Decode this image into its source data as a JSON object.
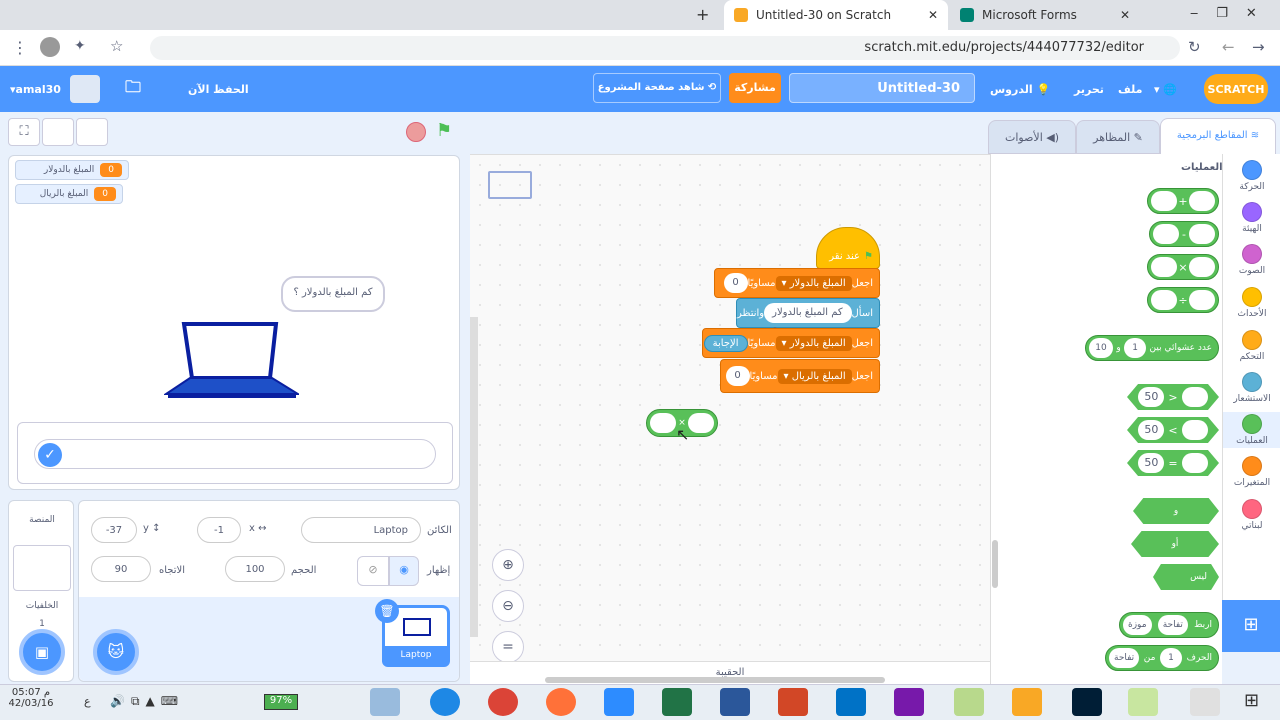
{
  "browser": {
    "tabs": [
      {
        "label": "Untitled-30 on Scratch"
      },
      {
        "label": "Microsoft Forms"
      }
    ],
    "new_tab": "+",
    "url": "scratch.mit.edu/projects/444077732/editor"
  },
  "menubar": {
    "logo": "SCRATCH",
    "file": "ملف",
    "edit": "تحرير",
    "tutorials": "الدروس",
    "project_title": "Untitled-30",
    "share": "مشاركة",
    "see_project": "شاهد صفحة المشروع",
    "save_now": "الحفظ الآن",
    "username": "amal30"
  },
  "editor_tabs": {
    "code": "المقاطع البرمجية",
    "costumes": "المظاهر",
    "sounds": "الأصوات"
  },
  "categories": [
    {
      "label": "الحركة",
      "color": "#4c97ff"
    },
    {
      "label": "الهيئة",
      "color": "#9966ff"
    },
    {
      "label": "الصوت",
      "color": "#cf63cf"
    },
    {
      "label": "الأحداث",
      "color": "#ffbf00"
    },
    {
      "label": "التحكم",
      "color": "#ffab19"
    },
    {
      "label": "الاستشعار",
      "color": "#5cb1d6"
    },
    {
      "label": "العمليات",
      "color": "#59c059"
    },
    {
      "label": "المتغيرات",
      "color": "#ff8c1a"
    },
    {
      "label": "لبناتي",
      "color": "#ff6680"
    }
  ],
  "palette": {
    "heading": "العمليات",
    "ops": [
      "+",
      "-",
      "×",
      "÷"
    ],
    "random": {
      "label": "عدد عشوائي بين",
      "from": "1",
      "and": "و",
      "to": "10"
    },
    "compare": [
      {
        "op": ">",
        "val": "50"
      },
      {
        "op": "<",
        "val": "50"
      },
      {
        "op": "=",
        "val": "50"
      }
    ],
    "and": "و",
    "or": "أو",
    "not": "ليس",
    "join": {
      "label": "اربط",
      "a": "تفاحة",
      "b": "موزة"
    },
    "letter": {
      "label": "الحرف",
      "n": "1",
      "of": "من",
      "word": "تفاحة"
    }
  },
  "script": {
    "hat": "عند نقر",
    "set1": {
      "label": "اجعل",
      "var": "المبلغ بالدولار",
      "to": "مساويًا",
      "val": "0"
    },
    "ask": {
      "label": "اسأل",
      "q": "كم المبلغ بالدولار ؟",
      "wait": "وانتظر"
    },
    "set2": {
      "label": "اجعل",
      "var": "المبلغ بالدولار",
      "to": "مساويًا",
      "val": "الإجابة"
    },
    "set3": {
      "label": "اجعل",
      "var": "المبلغ بالريال",
      "to": "مساويًا",
      "val": "0"
    },
    "loose_op": "×"
  },
  "stage": {
    "monitors": [
      {
        "label": "المبلغ بالدولار",
        "value": "0"
      },
      {
        "label": "المبلغ بالريال",
        "value": "0"
      }
    ],
    "speech": "كم المبلغ بالدولار ؟"
  },
  "sprite_info": {
    "sprite_label": "الكائن",
    "sprite_name": "Laptop",
    "x_label": "x",
    "x": "-1",
    "y_label": "y",
    "y": "-37",
    "show_label": "إظهار",
    "size_label": "الحجم",
    "size": "100",
    "direction_label": "الاتجاه",
    "direction": "90",
    "thumb_name": "Laptop"
  },
  "stage_panel": {
    "title": "المنصة",
    "backdrops_label": "الخلفيات",
    "backdrops_count": "1"
  },
  "backpack": "الحقيبة",
  "taskbar": {
    "time": "05:07 م",
    "date": "42/03/16",
    "battery": "97%",
    "lang": "ع"
  }
}
